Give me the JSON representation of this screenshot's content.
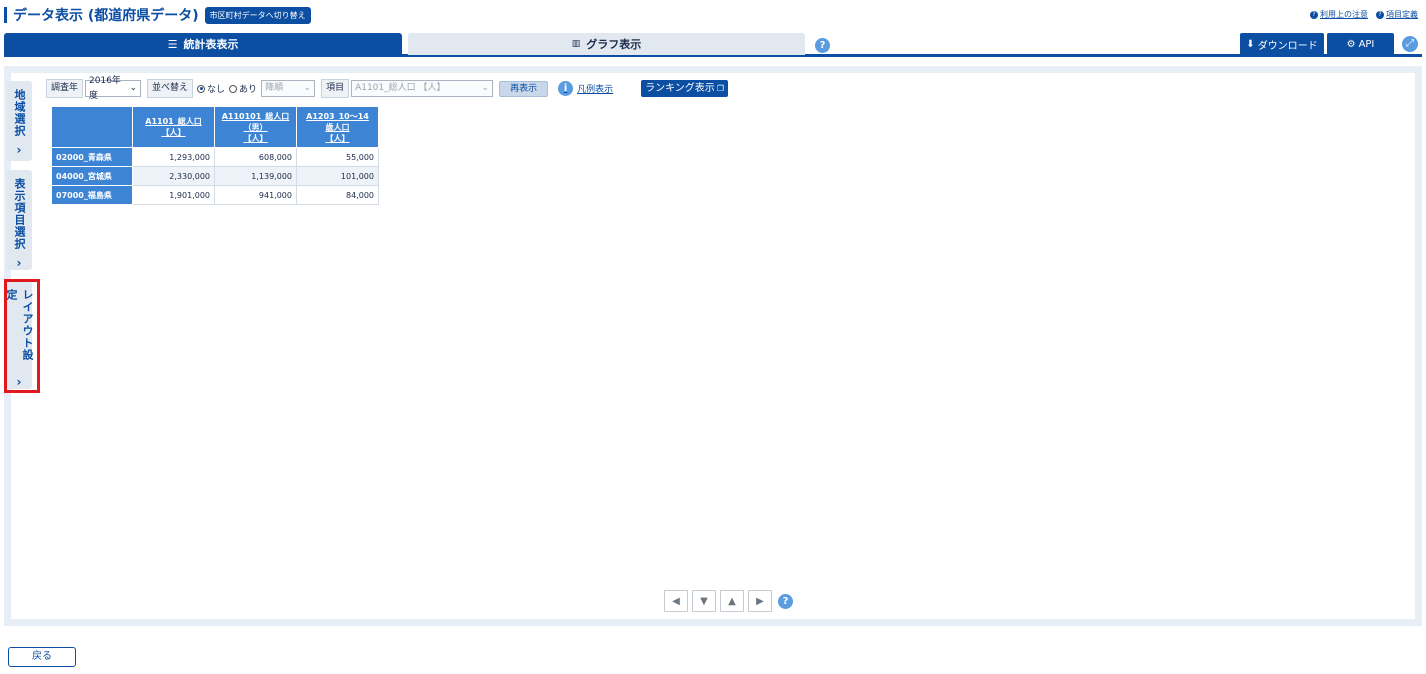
{
  "header": {
    "title": "データ表示 (都道府県データ)",
    "switch_button": "市区町村データへ切り替え",
    "links": [
      "利用上の注意",
      "項目定義"
    ]
  },
  "tabs": {
    "stats_table": "統計表表示",
    "graph": "グラフ表示"
  },
  "actions": {
    "download": "ダウンロード",
    "api": "API"
  },
  "side_tabs": {
    "region": "地域選択",
    "items": "表示項目選択",
    "layout": "レイアウト設定"
  },
  "toolbar": {
    "year_label": "調査年",
    "year_value": "2016年度",
    "sort_label": "並べ替え",
    "sort_none": "なし",
    "sort_yes": "あり",
    "order_value": "降順",
    "item_label": "項目",
    "item_value": "A1101_総人口 【人】",
    "redisplay": "再表示",
    "legend": "凡例表示",
    "ranking": "ランキング表示"
  },
  "table": {
    "columns": [
      {
        "l1": "A1101_総人口",
        "l2": "【人】",
        "l3": ""
      },
      {
        "l1": "A110101_総人口",
        "l2": "（男）",
        "l3": "【人】"
      },
      {
        "l1": "A1203_10～14",
        "l2": "歳人口",
        "l3": "【人】"
      }
    ],
    "rows": [
      {
        "label": "02000_青森県",
        "values": [
          "1,293,000",
          "608,000",
          "55,000"
        ]
      },
      {
        "label": "04000_宮城県",
        "values": [
          "2,330,000",
          "1,139,000",
          "101,000"
        ]
      },
      {
        "label": "07000_福島県",
        "values": [
          "1,901,000",
          "941,000",
          "84,000"
        ]
      }
    ]
  },
  "footer": {
    "back": "戻る"
  },
  "colors": {
    "brand": "#0b4ea2",
    "table_header": "#3d85d4",
    "highlight": "#e0191e"
  }
}
